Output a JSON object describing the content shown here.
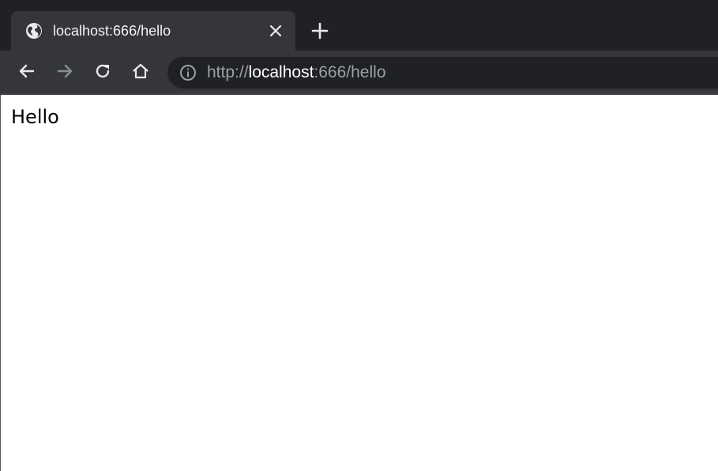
{
  "tab": {
    "title": "localhost:666/hello",
    "favicon": "globe-icon"
  },
  "toolbar": {
    "back_icon": "arrow-left-icon",
    "forward_icon": "arrow-right-icon",
    "reload_icon": "reload-icon",
    "home_icon": "home-icon"
  },
  "omnibox": {
    "scheme": "http://",
    "host": "localhost",
    "rest": ":666/hello",
    "security_icon": "info-icon"
  },
  "page": {
    "text": "Hello"
  },
  "colors": {
    "tabstrip": "#202124",
    "active_tab": "#35363a",
    "omnibox": "#202124",
    "url_dim": "#9aa0a6"
  }
}
